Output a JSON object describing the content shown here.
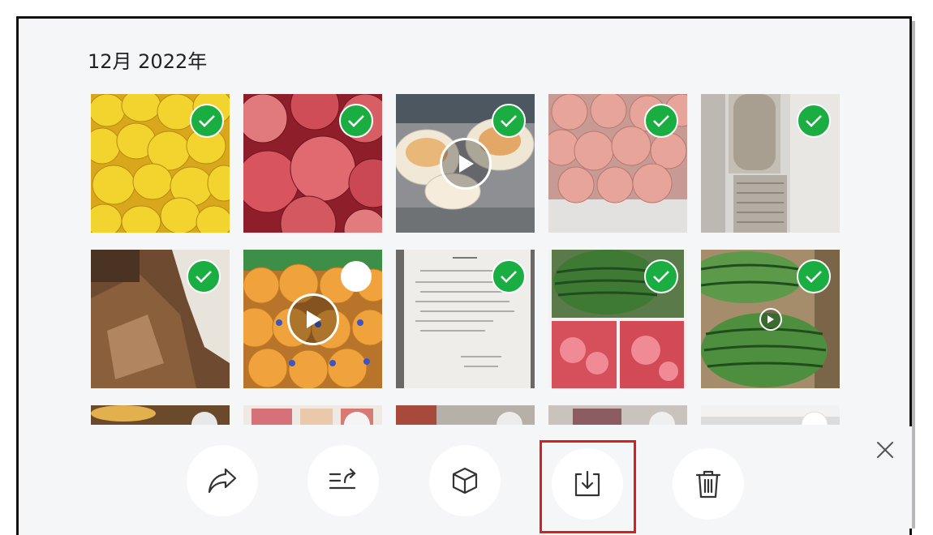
{
  "header": {
    "date_title": "12月 2022年"
  },
  "photos": [
    {
      "name": "lemons",
      "selected": true,
      "type": "photo"
    },
    {
      "name": "red-apples",
      "selected": true,
      "type": "photo"
    },
    {
      "name": "food-plates",
      "selected": true,
      "type": "video"
    },
    {
      "name": "bagged-apples",
      "selected": true,
      "type": "photo"
    },
    {
      "name": "storage-shelf",
      "selected": true,
      "type": "photo"
    },
    {
      "name": "wood-bag",
      "selected": true,
      "type": "photo"
    },
    {
      "name": "oranges-box",
      "selected": false,
      "type": "video"
    },
    {
      "name": "document",
      "selected": true,
      "type": "photo"
    },
    {
      "name": "watermelon-collage",
      "selected": true,
      "type": "photo"
    },
    {
      "name": "watermelons",
      "selected": true,
      "type": "video"
    }
  ],
  "toolbar": {
    "buttons": [
      {
        "name": "share",
        "icon": "share-icon"
      },
      {
        "name": "sort-arrange",
        "icon": "sort-arrow-icon"
      },
      {
        "name": "3d-box",
        "icon": "cube-icon"
      },
      {
        "name": "download",
        "icon": "download-icon",
        "highlighted": true
      },
      {
        "name": "delete",
        "icon": "trash-icon"
      }
    ],
    "close_icon": "close-icon",
    "highlight_color": "#d42222"
  },
  "colors": {
    "selected_check": "#1aad42",
    "background": "#f5f6f7"
  }
}
